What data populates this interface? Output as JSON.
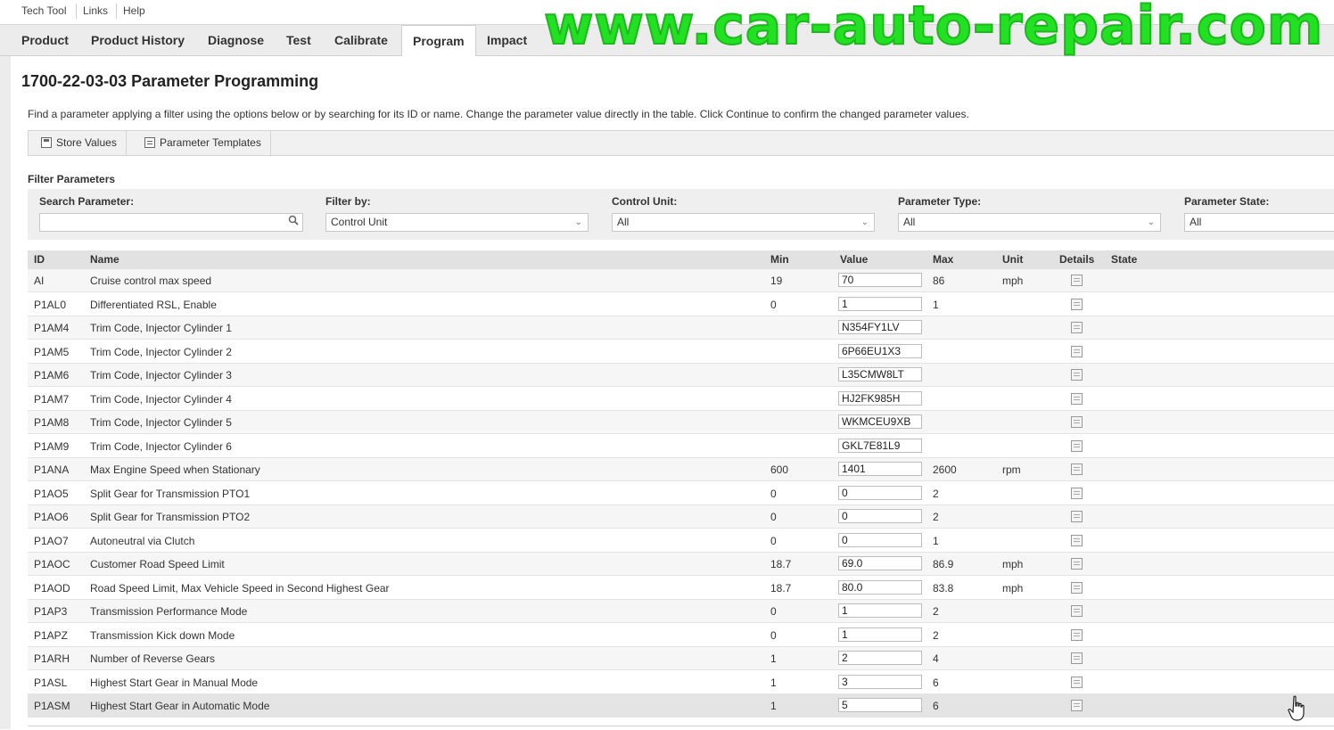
{
  "menu": {
    "items": [
      "Tech Tool",
      "Links",
      "Help"
    ]
  },
  "tabs": {
    "items": [
      "Product",
      "Product History",
      "Diagnose",
      "Test",
      "Calibrate",
      "Program",
      "Impact"
    ],
    "active": "Program"
  },
  "watermark": "www.car-auto-repair.com",
  "page": {
    "title": "1700-22-03-03 Parameter Programming",
    "description": "Find a parameter applying a filter using the options below or by searching for its ID or name. Change the parameter value directly in the table. Click Continue to confirm the changed parameter values."
  },
  "toolbar": {
    "store_values": "Store Values",
    "parameter_templates": "Parameter Templates"
  },
  "filter": {
    "title": "Filter Parameters",
    "search_label": "Search Parameter:",
    "search_value": "",
    "filter_by_label": "Filter by:",
    "filter_by_value": "Control Unit",
    "control_unit_label": "Control Unit:",
    "control_unit_value": "All",
    "parameter_type_label": "Parameter Type:",
    "parameter_type_value": "All",
    "parameter_state_label": "Parameter State:",
    "parameter_state_value": "All"
  },
  "columns": {
    "id": "ID",
    "name": "Name",
    "min": "Min",
    "value": "Value",
    "max": "Max",
    "unit": "Unit",
    "details": "Details",
    "state": "State"
  },
  "rows": [
    {
      "id": "AI",
      "name": "Cruise control max speed",
      "min": "19",
      "value": "70",
      "max": "86",
      "unit": "mph"
    },
    {
      "id": "P1AL0",
      "name": "Differentiated RSL, Enable",
      "min": "0",
      "value": "1",
      "max": "1",
      "unit": ""
    },
    {
      "id": "P1AM4",
      "name": "Trim Code, Injector Cylinder 1",
      "min": "",
      "value": "N354FY1LV",
      "max": "",
      "unit": ""
    },
    {
      "id": "P1AM5",
      "name": "Trim Code, Injector Cylinder 2",
      "min": "",
      "value": "6P66EU1X3",
      "max": "",
      "unit": ""
    },
    {
      "id": "P1AM6",
      "name": "Trim Code, Injector Cylinder 3",
      "min": "",
      "value": "L35CMW8LT",
      "max": "",
      "unit": ""
    },
    {
      "id": "P1AM7",
      "name": "Trim Code, Injector Cylinder 4",
      "min": "",
      "value": "HJ2FK985H",
      "max": "",
      "unit": ""
    },
    {
      "id": "P1AM8",
      "name": "Trim Code, Injector Cylinder 5",
      "min": "",
      "value": "WKMCEU9XB",
      "max": "",
      "unit": ""
    },
    {
      "id": "P1AM9",
      "name": "Trim Code, Injector Cylinder 6",
      "min": "",
      "value": "GKL7E81L9",
      "max": "",
      "unit": ""
    },
    {
      "id": "P1ANA",
      "name": "Max Engine Speed when Stationary",
      "min": "600",
      "value": "1401",
      "max": "2600",
      "unit": "rpm"
    },
    {
      "id": "P1AO5",
      "name": "Split Gear for Transmission PTO1",
      "min": "0",
      "value": "0",
      "max": "2",
      "unit": ""
    },
    {
      "id": "P1AO6",
      "name": "Split Gear for Transmission PTO2",
      "min": "0",
      "value": "0",
      "max": "2",
      "unit": ""
    },
    {
      "id": "P1AO7",
      "name": "Autoneutral via Clutch",
      "min": "0",
      "value": "0",
      "max": "1",
      "unit": ""
    },
    {
      "id": "P1AOC",
      "name": "Customer Road Speed Limit",
      "min": "18.7",
      "value": "69.0",
      "max": "86.9",
      "unit": "mph"
    },
    {
      "id": "P1AOD",
      "name": "Road Speed Limit, Max Vehicle Speed in Second Highest Gear",
      "min": "18.7",
      "value": "80.0",
      "max": "83.8",
      "unit": "mph"
    },
    {
      "id": "P1AP3",
      "name": "Transmission Performance Mode",
      "min": "0",
      "value": "1",
      "max": "2",
      "unit": ""
    },
    {
      "id": "P1APZ",
      "name": "Transmission Kick down Mode",
      "min": "0",
      "value": "1",
      "max": "2",
      "unit": ""
    },
    {
      "id": "P1ARH",
      "name": "Number of Reverse Gears",
      "min": "1",
      "value": "2",
      "max": "4",
      "unit": ""
    },
    {
      "id": "P1ASL",
      "name": "Highest Start Gear in Manual Mode",
      "min": "1",
      "value": "3",
      "max": "6",
      "unit": ""
    },
    {
      "id": "P1ASM",
      "name": "Highest Start Gear in Automatic Mode",
      "min": "1",
      "value": "5",
      "max": "6",
      "unit": ""
    }
  ],
  "selected_row": 18
}
